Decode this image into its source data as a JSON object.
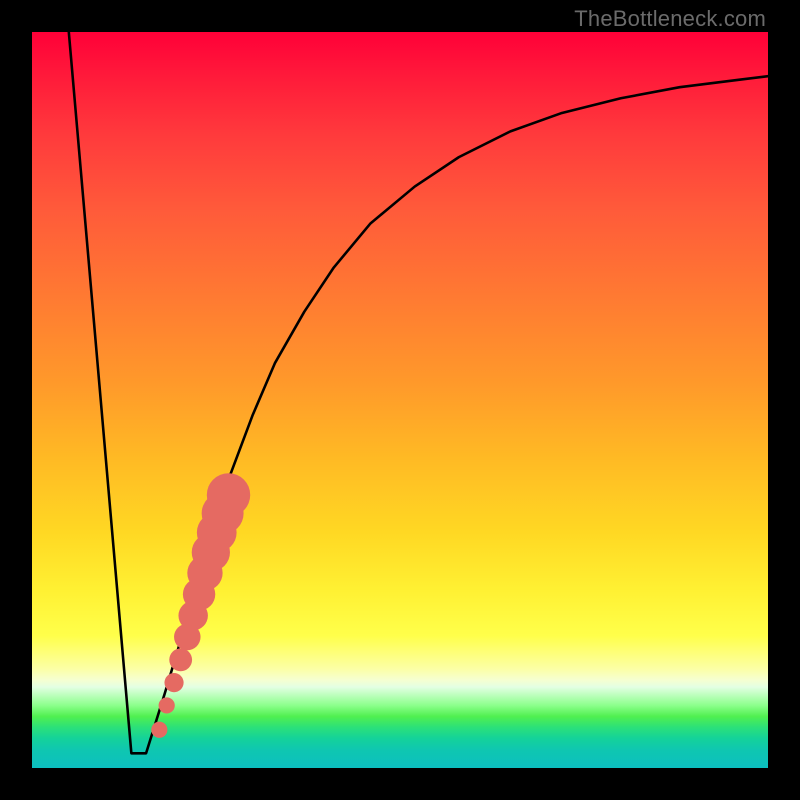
{
  "watermark": "TheBottleneck.com",
  "chart_data": {
    "type": "line",
    "title": "",
    "xlabel": "",
    "ylabel": "",
    "xlim": [
      0,
      100
    ],
    "ylim": [
      0,
      100
    ],
    "grid": false,
    "legend": false,
    "series": [
      {
        "name": "left-descent",
        "x": [
          5,
          13.5
        ],
        "y": [
          100,
          2
        ],
        "stroke": "#000000"
      },
      {
        "name": "valley-floor",
        "x": [
          13.5,
          15.5
        ],
        "y": [
          2,
          2
        ],
        "stroke": "#000000"
      },
      {
        "name": "right-curve",
        "x": [
          15.5,
          18,
          21,
          24,
          27,
          30,
          33,
          37,
          41,
          46,
          52,
          58,
          65,
          72,
          80,
          88,
          96,
          100
        ],
        "y": [
          2,
          10,
          20,
          30,
          40,
          48,
          55,
          62,
          68,
          74,
          79,
          83,
          86.5,
          89,
          91,
          92.5,
          93.5,
          94
        ],
        "stroke": "#000000"
      }
    ],
    "markers": {
      "name": "exclamation-dots",
      "color": "#e56a62",
      "points": [
        {
          "x": 17.3,
          "y": 5.2,
          "r": 1.1
        },
        {
          "x": 18.3,
          "y": 8.5,
          "r": 1.1
        },
        {
          "x": 19.3,
          "y": 11.6,
          "r": 1.3
        },
        {
          "x": 20.2,
          "y": 14.7,
          "r": 1.55
        },
        {
          "x": 21.1,
          "y": 17.8,
          "r": 1.8
        },
        {
          "x": 21.9,
          "y": 20.7,
          "r": 2.0
        },
        {
          "x": 22.7,
          "y": 23.6,
          "r": 2.2
        },
        {
          "x": 23.5,
          "y": 26.5,
          "r": 2.4
        },
        {
          "x": 24.3,
          "y": 29.3,
          "r": 2.6
        },
        {
          "x": 25.1,
          "y": 32.0,
          "r": 2.7
        },
        {
          "x": 25.9,
          "y": 34.6,
          "r": 2.85
        },
        {
          "x": 26.7,
          "y": 37.1,
          "r": 2.95
        }
      ]
    }
  }
}
